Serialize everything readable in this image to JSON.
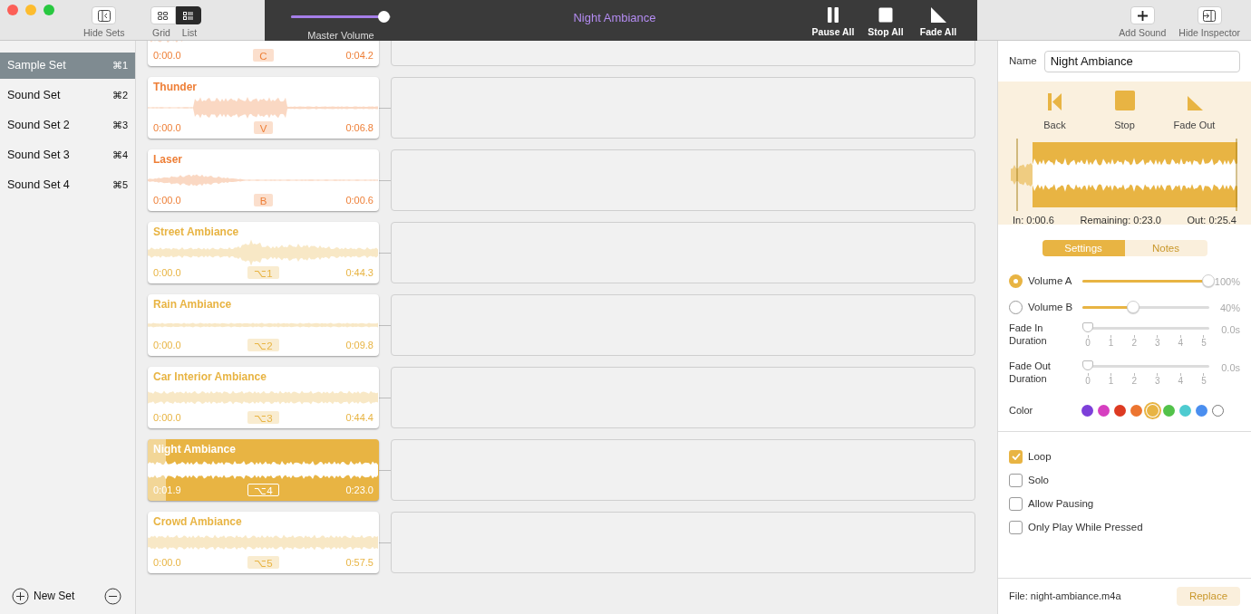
{
  "toolbar": {
    "hide_sets": "Hide Sets",
    "view_modes": [
      {
        "kind": "grid",
        "label": "Grid",
        "selected": false
      },
      {
        "kind": "list",
        "label": "List",
        "selected": true
      }
    ],
    "master_volume": {
      "label": "Master Volume",
      "level": 0.93
    },
    "title": "Night Ambiance",
    "transport": [
      {
        "kind": "pause",
        "label": "Pause All"
      },
      {
        "kind": "stop",
        "label": "Stop All"
      },
      {
        "kind": "fade",
        "label": "Fade All"
      }
    ],
    "actions": [
      {
        "kind": "add",
        "label": "Add Sound"
      },
      {
        "kind": "inspector",
        "label": "Hide Inspector"
      }
    ]
  },
  "sidebar": {
    "items": [
      {
        "label": "Sample Set",
        "shortcut": "⌘1",
        "selected": true
      },
      {
        "label": "Sound Set",
        "shortcut": "⌘2",
        "selected": false
      },
      {
        "label": "Sound Set 2",
        "shortcut": "⌘3",
        "selected": false
      },
      {
        "label": "Sound Set 3",
        "shortcut": "⌘4",
        "selected": false
      },
      {
        "label": "Sound Set 4",
        "shortcut": "⌘5",
        "selected": false
      }
    ],
    "new_set": "New Set"
  },
  "sounds": [
    {
      "start": "0:00.0",
      "key": "C",
      "end": "0:04.2",
      "color": "#ee7f37",
      "selected": false
    },
    {
      "name": "Thunder",
      "start": "0:00.0",
      "key": "V",
      "end": "0:06.8",
      "color": "#ee7f37",
      "selected": false
    },
    {
      "name": "Laser",
      "start": "0:00.0",
      "key": "B",
      "end": "0:00.6",
      "color": "#ee7f37",
      "selected": false
    },
    {
      "name": "Street Ambiance",
      "start": "0:00.0",
      "key": "⌥1",
      "end": "0:44.3",
      "color": "#e8b443",
      "selected": false
    },
    {
      "name": "Rain Ambiance",
      "start": "0:00.0",
      "key": "⌥2",
      "end": "0:09.8",
      "color": "#e8b443",
      "selected": false
    },
    {
      "name": "Car Interior Ambiance",
      "start": "0:00.0",
      "key": "⌥3",
      "end": "0:44.4",
      "color": "#e8b443",
      "selected": false
    },
    {
      "name": "Night Ambiance",
      "start": "0:01.9",
      "key": "⌥4",
      "end": "0:23.0",
      "color": "#e8b443",
      "selected": true,
      "level": 0.08
    },
    {
      "name": "Crowd Ambiance",
      "start": "0:00.0",
      "key": "⌥5",
      "end": "0:57.5",
      "color": "#e8b443",
      "selected": false
    }
  ],
  "inspector": {
    "name_label": "Name",
    "name_value": "Night Ambiance",
    "transport": [
      {
        "kind": "back",
        "label": "Back"
      },
      {
        "kind": "stop",
        "label": "Stop"
      },
      {
        "kind": "fade",
        "label": "Fade Out"
      }
    ],
    "in": "In: 0:00.6",
    "remaining": "Remaining: 0:23.0",
    "out": "Out: 0:25.4",
    "tabs": [
      {
        "label": "Settings",
        "selected": true
      },
      {
        "label": "Notes",
        "selected": false
      }
    ],
    "volumes": [
      {
        "label": "Volume A",
        "selected": true,
        "level": 1.0,
        "reading": "100%"
      },
      {
        "label": "Volume B",
        "selected": false,
        "level": 0.4,
        "reading": "40%"
      }
    ],
    "fades": [
      {
        "label": "Fade In Duration",
        "level": 0,
        "reading": "0.0s",
        "ticks": [
          "0",
          "1",
          "2",
          "3",
          "4",
          "5"
        ]
      },
      {
        "label": "Fade Out Duration",
        "level": 0,
        "reading": "0.0s",
        "ticks": [
          "0",
          "1",
          "2",
          "3",
          "4",
          "5"
        ]
      }
    ],
    "color_label": "Color",
    "colors": [
      {
        "color": "#7d3fd9",
        "selected": false
      },
      {
        "color": "#d63fc0",
        "selected": false
      },
      {
        "color": "#dd3a22",
        "selected": false
      },
      {
        "color": "#ec7530",
        "selected": false
      },
      {
        "color": "#e8b443",
        "selected": true
      },
      {
        "color": "#52c24a",
        "selected": false
      },
      {
        "color": "#4ecbd0",
        "selected": false
      },
      {
        "color": "#4a8eef",
        "selected": false
      },
      {
        "color": "#ffffff",
        "selected": false
      }
    ],
    "options": [
      {
        "label": "Loop",
        "checked": true
      },
      {
        "label": "Solo",
        "checked": false
      },
      {
        "label": "Allow Pausing",
        "checked": false
      },
      {
        "label": "Only Play While Pressed",
        "checked": false
      }
    ],
    "file": "File: night-ambiance.m4a",
    "replace": "Replace"
  }
}
